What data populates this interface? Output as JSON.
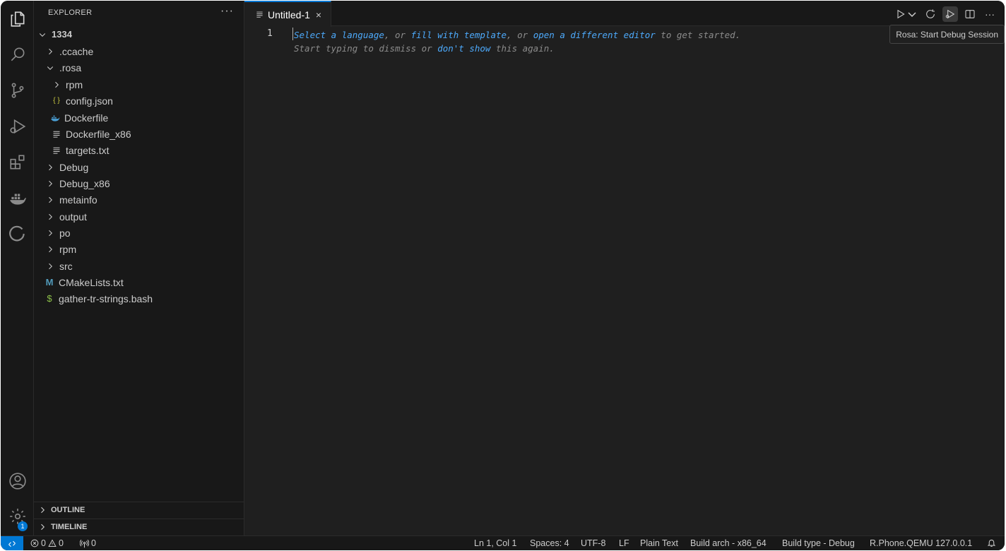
{
  "sidebar": {
    "title": "EXPLORER",
    "more": "···",
    "root": "1334",
    "items": [
      {
        "label": ".ccache"
      },
      {
        "label": ".rosa"
      },
      {
        "label": "rpm"
      },
      {
        "label": "config.json",
        "icon": "{ }"
      },
      {
        "label": "Dockerfile"
      },
      {
        "label": "Dockerfile_x86"
      },
      {
        "label": "targets.txt"
      },
      {
        "label": "Debug"
      },
      {
        "label": "Debug_x86"
      },
      {
        "label": "metainfo"
      },
      {
        "label": "output"
      },
      {
        "label": "po"
      },
      {
        "label": "rpm"
      },
      {
        "label": "src"
      },
      {
        "label": "CMakeLists.txt",
        "icon": "M"
      },
      {
        "label": "gather-tr-strings.bash",
        "icon": "$"
      }
    ],
    "sections": {
      "outline": "OUTLINE",
      "timeline": "TIMELINE"
    }
  },
  "activity": {
    "settings_badge": "1"
  },
  "editor": {
    "tab_label": "Untitled-1",
    "tab_close": "×",
    "line_number": "1",
    "hint_line1": {
      "p1": "Select a language",
      "p2": ", or ",
      "p3": "fill with template",
      "p4": ", or ",
      "p5": "open a different editor",
      "p6": " to get started."
    },
    "hint_line2": {
      "p1": "Start typing to dismiss or ",
      "p2": "don't show",
      "p3": " this again."
    },
    "tooltip": "Rosa: Start Debug Session",
    "more": "···"
  },
  "status": {
    "errors": "0",
    "warnings": "0",
    "ports": "0",
    "position": "Ln 1, Col 1",
    "spaces": "Spaces: 4",
    "encoding": "UTF-8",
    "eol": "LF",
    "language": "Plain Text",
    "build_arch": "Build arch - x86_64",
    "build_type": "Build type - Debug",
    "device": "R.Phone.QEMU 127.0.0.1"
  },
  "colors": {
    "accent": "#0078d4",
    "link": "#4daafc",
    "config_icon": "#cbcb41",
    "docker_icon": "#4a9fd4",
    "cmake_icon": "#519aba",
    "bash_icon": "#8dc149"
  }
}
